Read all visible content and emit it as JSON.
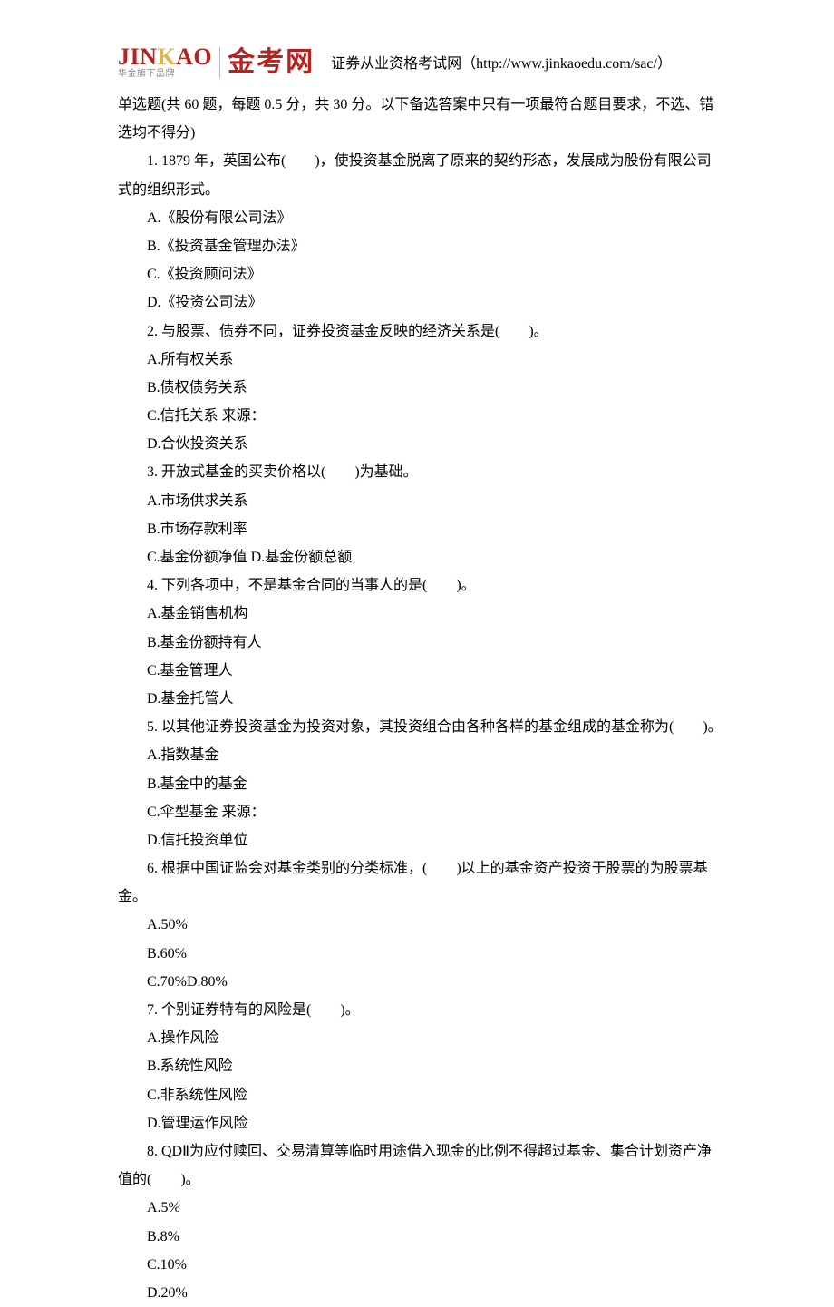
{
  "header": {
    "logo_en_j": "J",
    "logo_en_in": "IN",
    "logo_en_k": "K",
    "logo_en_ao": "AO",
    "logo_sub": "华金旗下品牌",
    "logo_cn": "金考网",
    "site_label": "证券从业资格考试网（http://www.jinkaoedu.com/sac/）"
  },
  "instructions": "单选题(共 60 题，每题 0.5 分，共 30 分。以下备选答案中只有一项最符合题目要求，不选、错选均不得分)",
  "questions": [
    {
      "stem": "1. 1879 年，英国公布(　　)，使投资基金脱离了原来的契约形态，发展成为股份有限公司式的组织形式。",
      "options": [
        "A.《股份有限公司法》",
        "B.《投资基金管理办法》",
        "C.《投资顾问法》",
        "D.《投资公司法》"
      ]
    },
    {
      "stem": "2. 与股票、债券不同，证券投资基金反映的经济关系是(　　)。",
      "options": [
        "A.所有权关系",
        "B.债权债务关系",
        "C.信托关系 来源：",
        "D.合伙投资关系"
      ]
    },
    {
      "stem": "3. 开放式基金的买卖价格以(　　)为基础。",
      "options": [
        "A.市场供求关系",
        "B.市场存款利率",
        "C.基金份额净值 D.基金份额总额"
      ]
    },
    {
      "stem": "4. 下列各项中，不是基金合同的当事人的是(　　)。",
      "options": [
        "A.基金销售机构",
        "B.基金份额持有人",
        "C.基金管理人",
        "D.基金托管人"
      ]
    },
    {
      "stem": "5. 以其他证券投资基金为投资对象，其投资组合由各种各样的基金组成的基金称为(　　)。",
      "options": [
        "A.指数基金",
        "B.基金中的基金",
        "C.伞型基金 来源：",
        "D.信托投资单位"
      ]
    },
    {
      "stem": "6. 根据中国证监会对基金类别的分类标准，(　　)以上的基金资产投资于股票的为股票基金。",
      "options": [
        "A.50%",
        "B.60%",
        "C.70%D.80%"
      ]
    },
    {
      "stem": "7. 个别证券特有的风险是(　　)。",
      "options": [
        "A.操作风险",
        "B.系统性风险",
        "C.非系统性风险",
        "D.管理运作风险"
      ]
    },
    {
      "stem": "8. QDⅡ为应付赎回、交易清算等临时用途借入现金的比例不得超过基金、集合计划资产净值的(　　)。",
      "options": [
        "A.5%",
        "B.8%",
        "C.10%",
        "D.20%"
      ]
    }
  ]
}
